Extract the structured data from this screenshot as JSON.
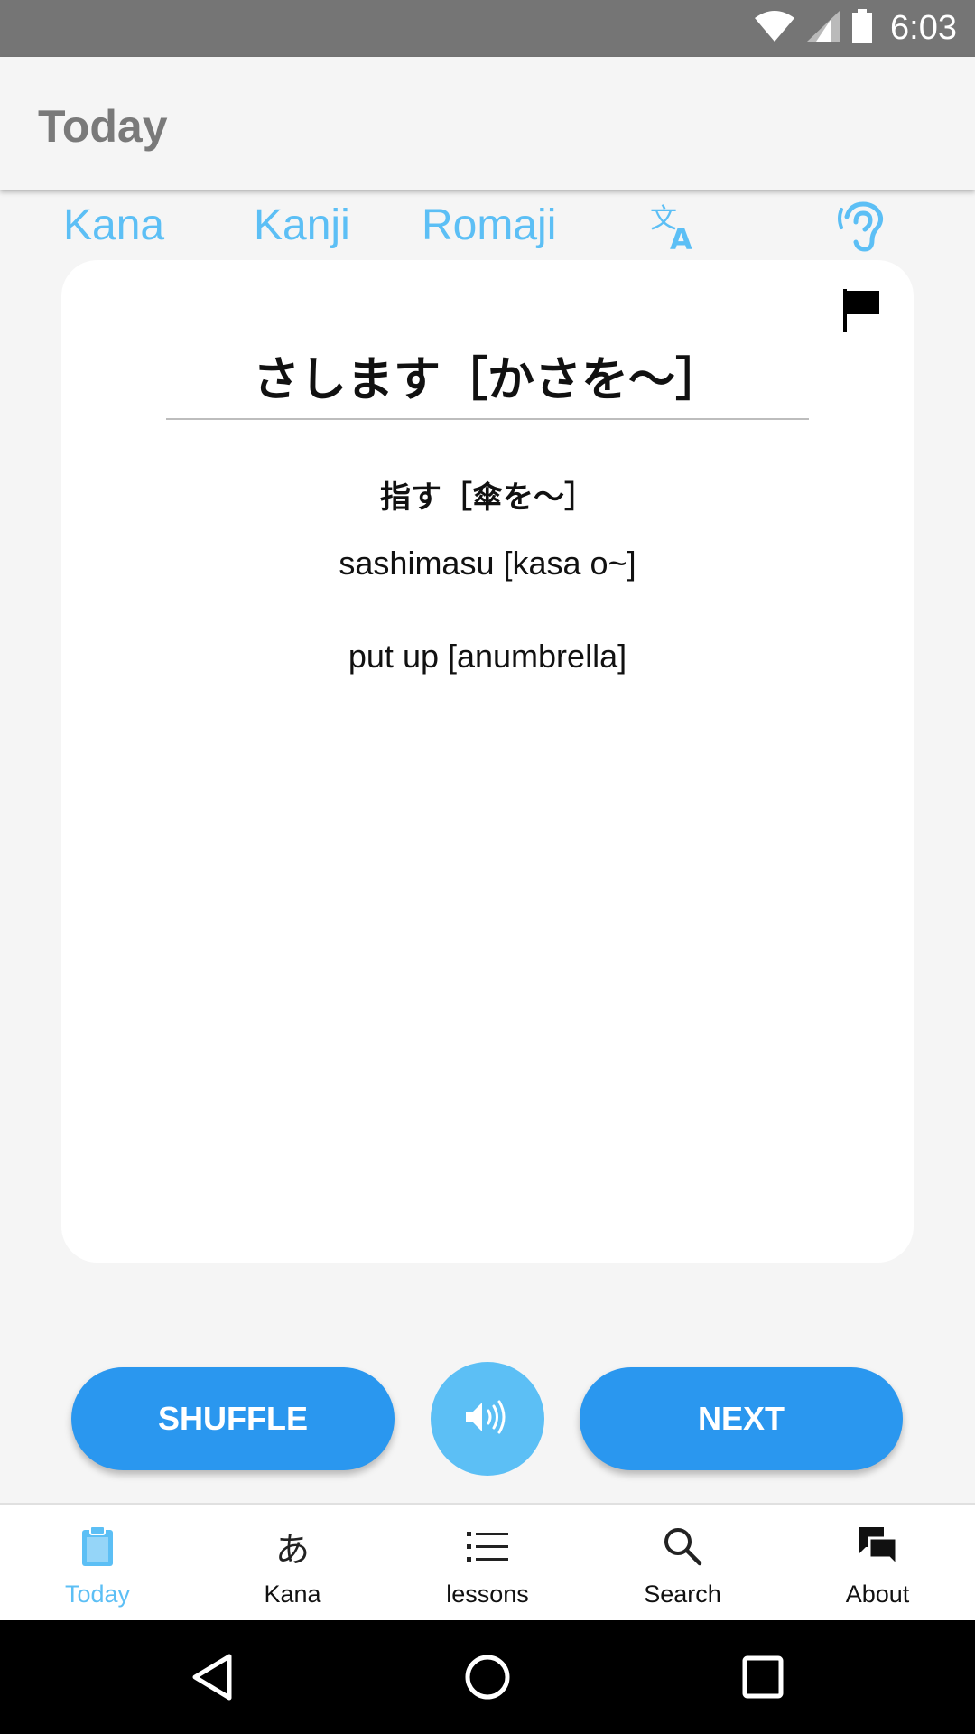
{
  "status_bar": {
    "time": "6:03"
  },
  "app_bar": {
    "title": "Today"
  },
  "modes": {
    "kana": "Kana",
    "kanji": "Kanji",
    "romaji": "Romaji",
    "translate_icon": "translate-icon",
    "listen_icon": "hearing-icon"
  },
  "card": {
    "kana": "さします［かさを～］",
    "kanji": "指す［傘を～］",
    "romaji": "sashimasu [kasa o~]",
    "meaning": "put up [anumbrella]",
    "flag_icon": "flag-icon"
  },
  "actions": {
    "shuffle_label": "SHUFFLE",
    "next_label": "NEXT",
    "sound_icon": "volume-icon"
  },
  "bottom_nav": {
    "items": [
      {
        "label": "Today",
        "icon": "clipboard-icon",
        "active": true
      },
      {
        "label": "Kana",
        "icon": "kana-icon",
        "glyph": "あ"
      },
      {
        "label": "lessons",
        "icon": "list-icon"
      },
      {
        "label": "Search",
        "icon": "search-icon"
      },
      {
        "label": "About",
        "icon": "chat-icon"
      }
    ]
  },
  "colors": {
    "accent": "#5cbff5",
    "primary_button": "#2a97ef",
    "status_bar": "#757575",
    "background": "#f5f5f5"
  }
}
